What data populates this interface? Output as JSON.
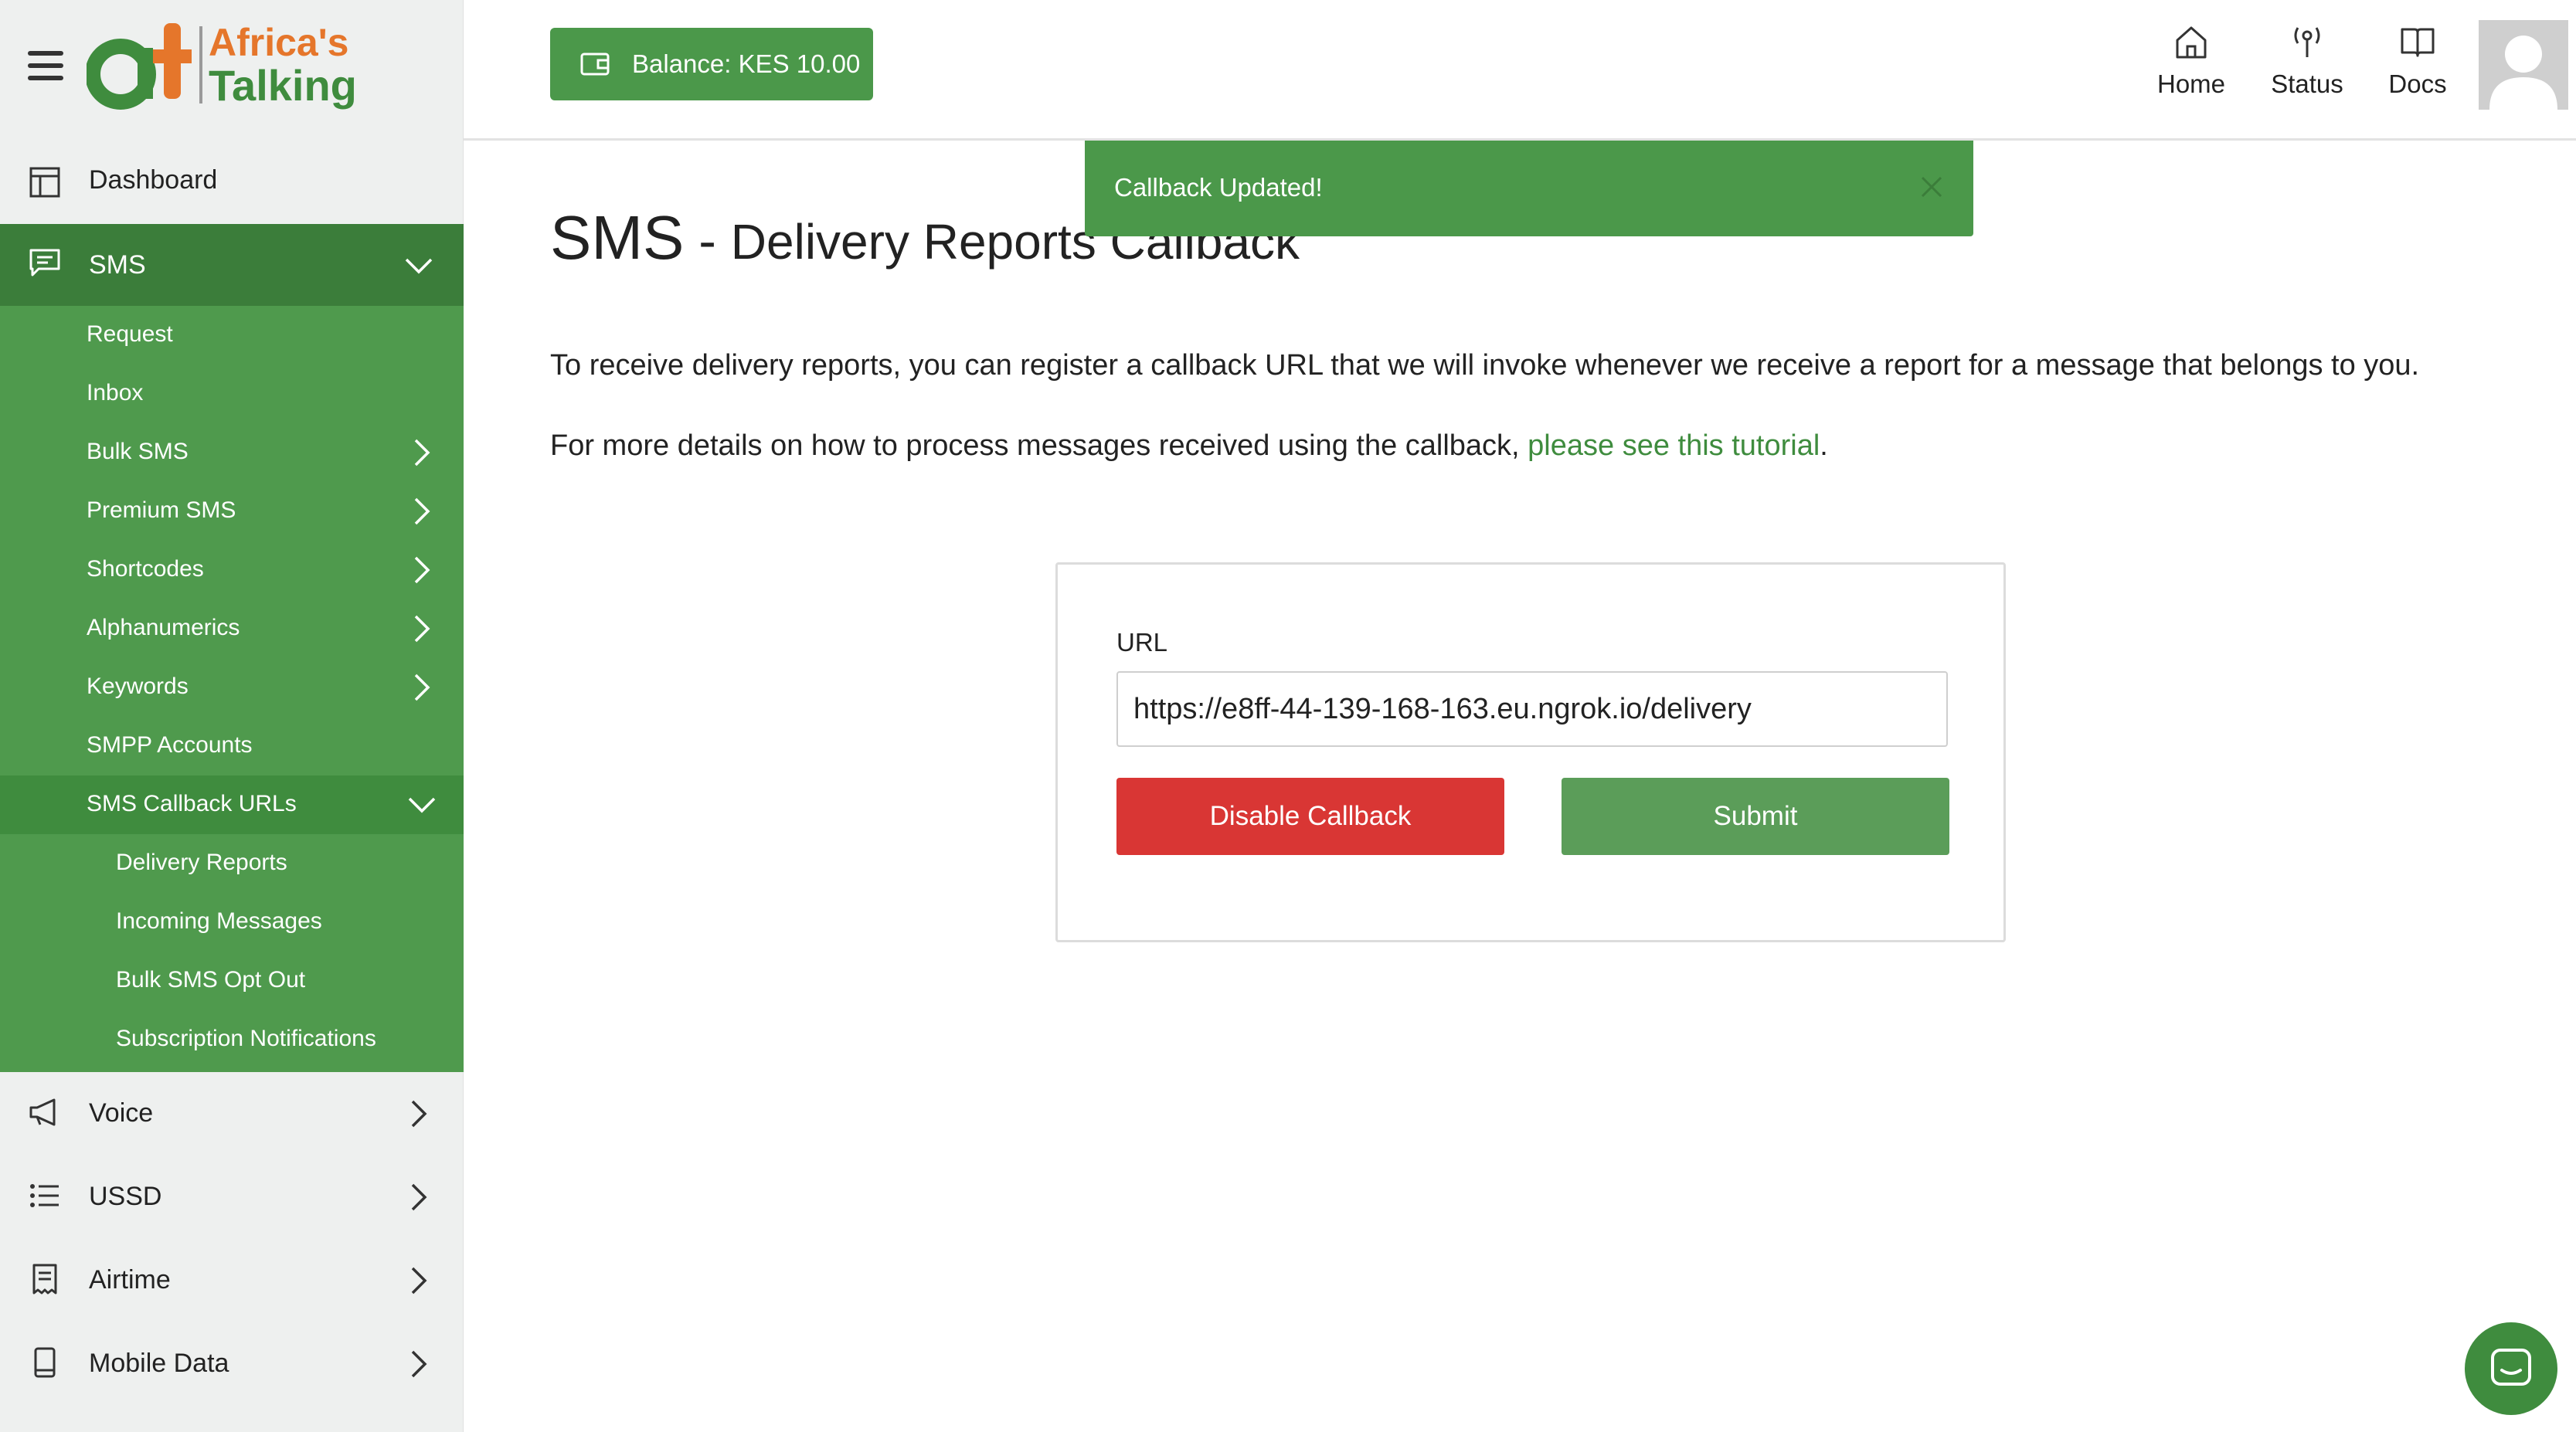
{
  "brand": {
    "logo_line1": "Africa's",
    "logo_line2": "Talking",
    "logo_mark": "at",
    "colors": {
      "orange": "#e5762b",
      "green": "#3f8c3e"
    }
  },
  "sidebar": {
    "dashboard": {
      "label": "Dashboard",
      "icon": "dashboard-icon"
    },
    "sms": {
      "label": "SMS",
      "icon": "message-icon",
      "expanded": true
    },
    "sms_items": [
      {
        "label": "Request"
      },
      {
        "label": "Inbox"
      },
      {
        "label": "Bulk SMS",
        "has_children": true
      },
      {
        "label": "Premium SMS",
        "has_children": true
      },
      {
        "label": "Shortcodes",
        "has_children": true
      },
      {
        "label": "Alphanumerics",
        "has_children": true
      },
      {
        "label": "Keywords",
        "has_children": true
      },
      {
        "label": "SMPP Accounts"
      },
      {
        "label": "SMS Callback URLs",
        "expanded": true
      }
    ],
    "callback_items": [
      {
        "label": "Delivery Reports"
      },
      {
        "label": "Incoming Messages"
      },
      {
        "label": "Bulk SMS Opt Out"
      },
      {
        "label": "Subscription Notifications"
      }
    ],
    "bottom_items": [
      {
        "label": "Voice",
        "icon": "megaphone-icon"
      },
      {
        "label": "USSD",
        "icon": "list-icon"
      },
      {
        "label": "Airtime",
        "icon": "receipt-icon"
      },
      {
        "label": "Mobile Data",
        "icon": "phone-icon"
      }
    ]
  },
  "header": {
    "balance_label": "Balance: KES 10.00",
    "nav": [
      {
        "label": "Home",
        "icon": "home-icon"
      },
      {
        "label": "Status",
        "icon": "antenna-icon"
      },
      {
        "label": "Docs",
        "icon": "book-icon"
      }
    ]
  },
  "toast": {
    "message": "Callback Updated!"
  },
  "page": {
    "title_main": "SMS",
    "title_sep": " - ",
    "title_sub": "Delivery Reports Callback",
    "intro": "To receive delivery reports, you can register a callback URL that we will invoke whenever we receive a report for a message that belongs to you.",
    "details_prefix": "For more details on how to process messages received using the callback, ",
    "details_link": "please see this tutorial",
    "details_suffix": "."
  },
  "form": {
    "url_label": "URL",
    "url_value": "https://e8ff-44-139-168-163.eu.ngrok.io/delivery",
    "disable_label": "Disable Callback",
    "submit_label": "Submit"
  },
  "colors": {
    "primary_green": "#4b984a",
    "sidebar_green": "#4f9a4d",
    "sidebar_dark_green": "#3b7d3a",
    "danger_red": "#d93634"
  }
}
